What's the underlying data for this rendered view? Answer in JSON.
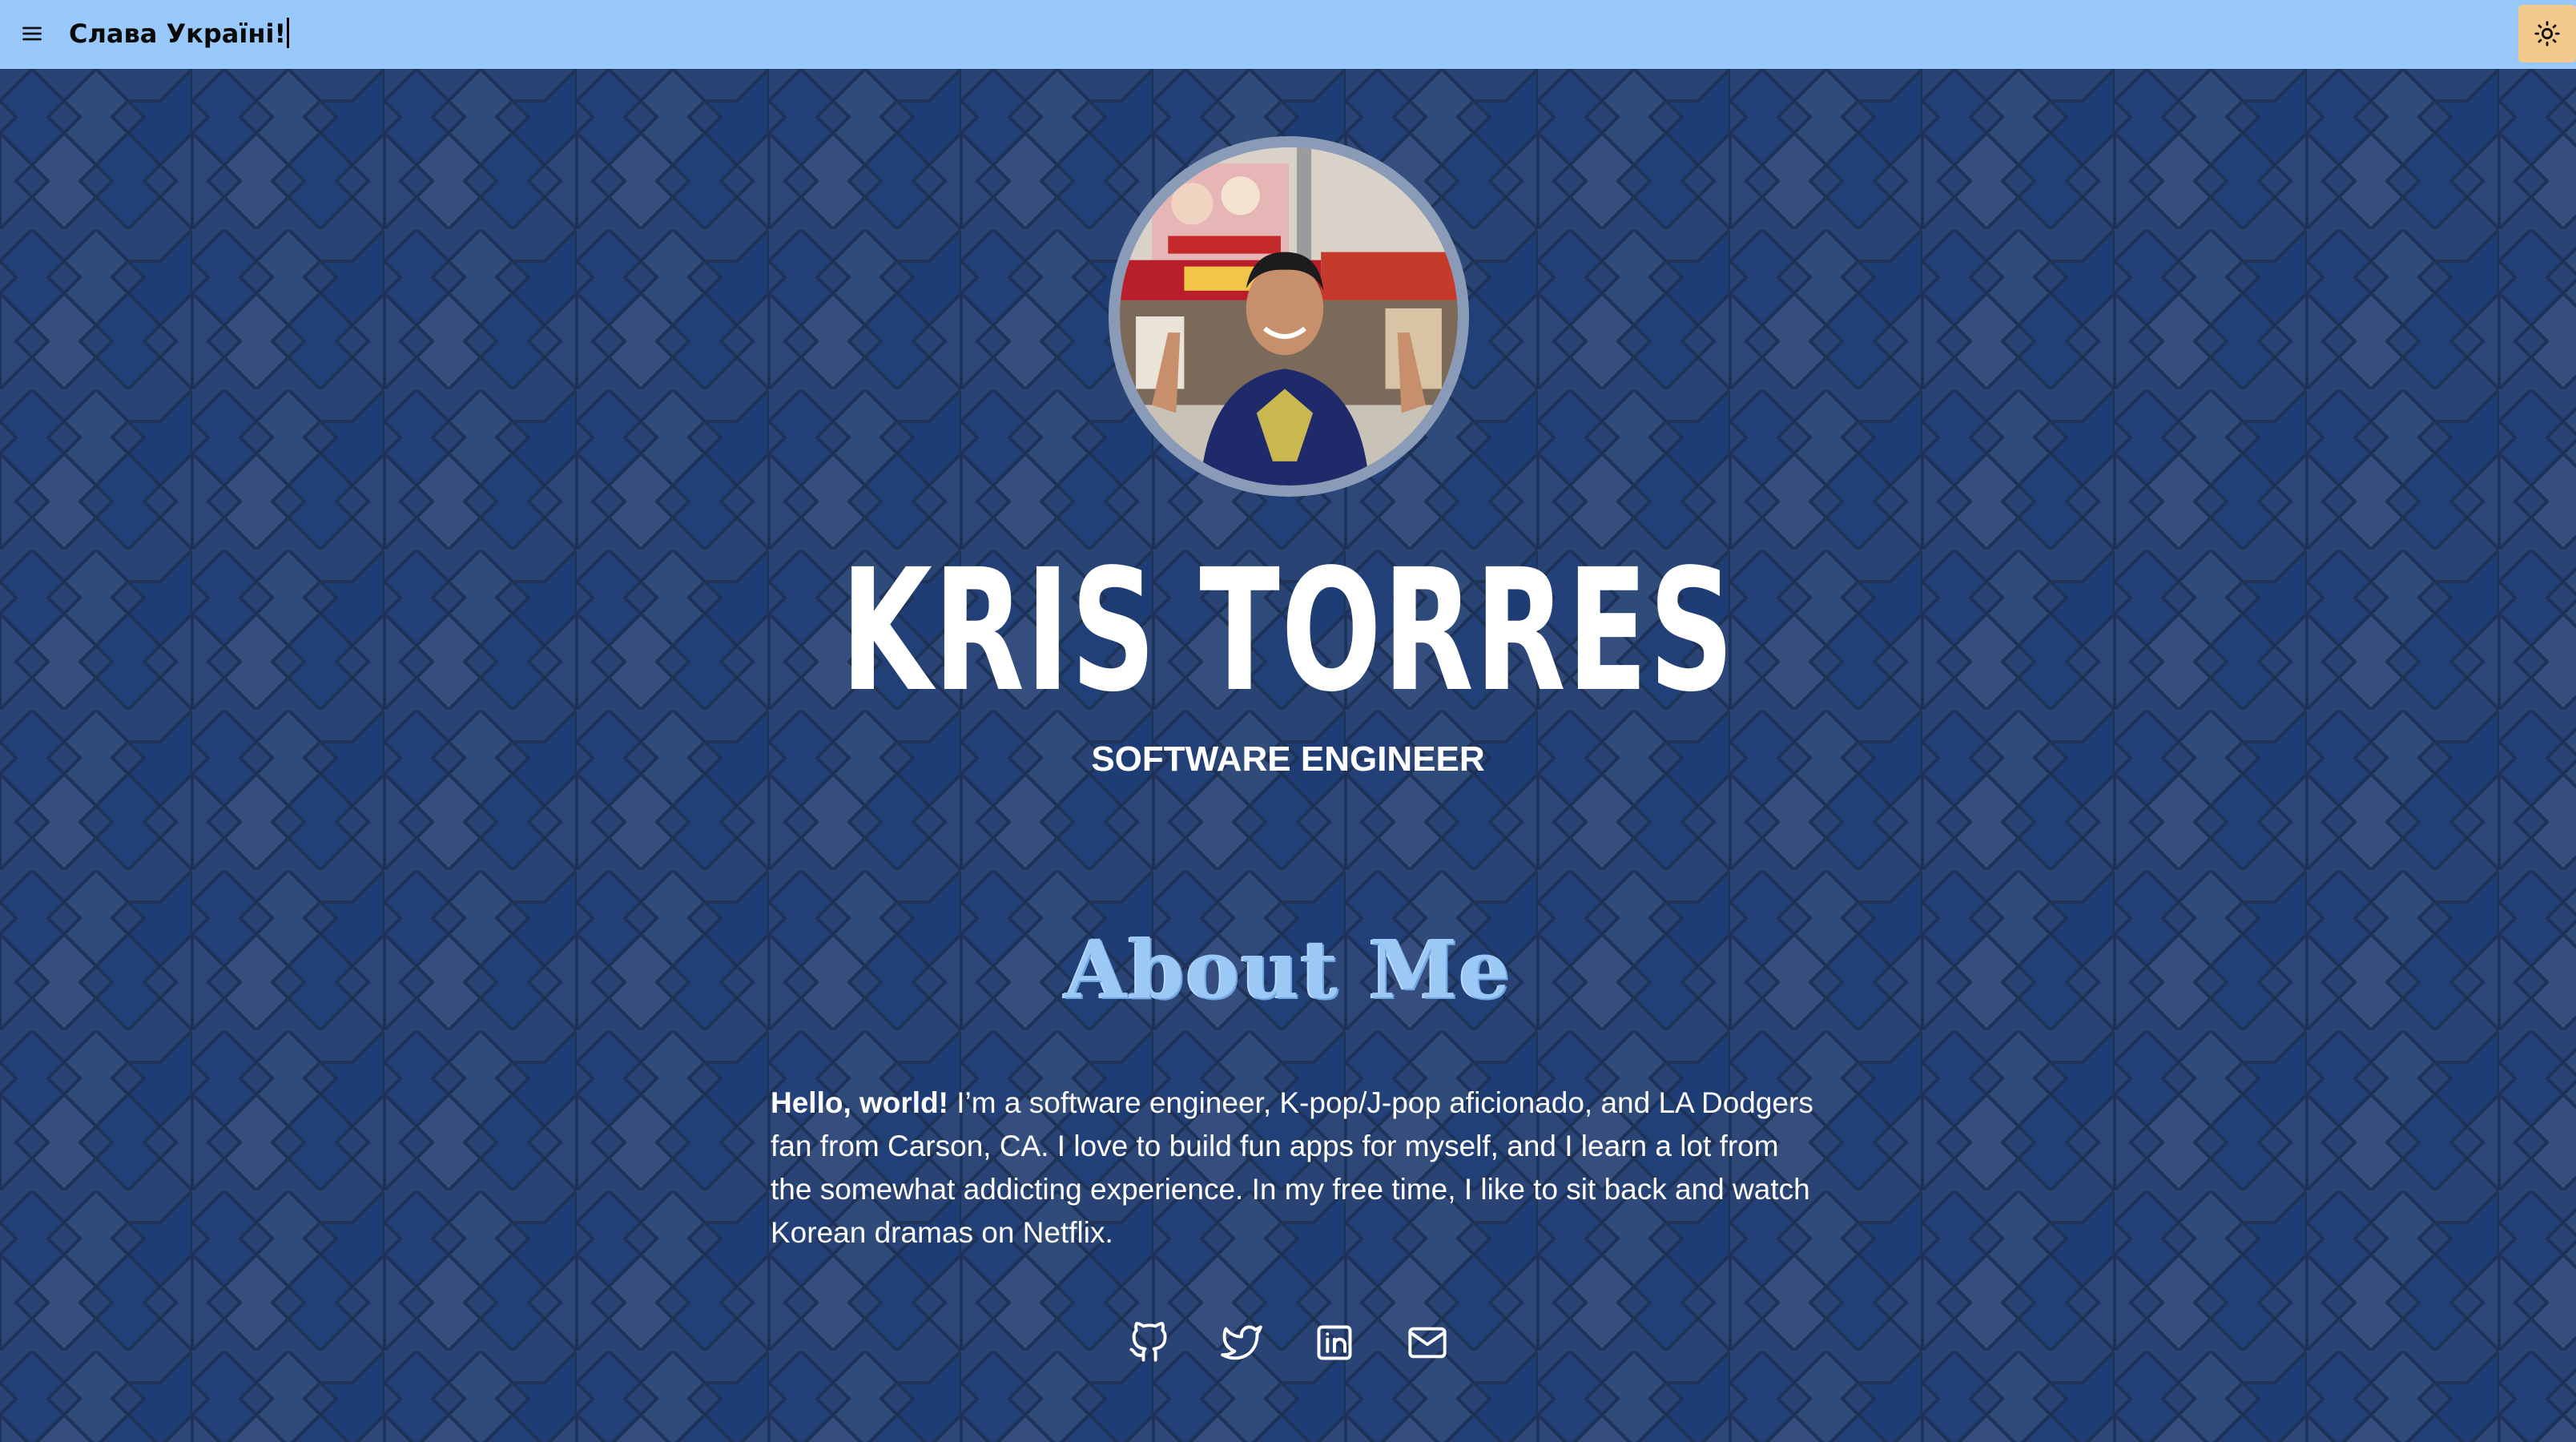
{
  "banner": {
    "text": "Слава Україні!"
  },
  "icons": {
    "menu": "menu-icon",
    "theme": "sun-icon",
    "github": "github-icon",
    "twitter": "twitter-icon",
    "linkedin": "linkedin-icon",
    "email": "mail-icon"
  },
  "profile": {
    "name": "KRIS TORRES",
    "title": "SOFTWARE ENGINEER"
  },
  "about": {
    "heading": "About Me",
    "intro_bold": "Hello, world!",
    "body": " I’m a software engineer, K-pop/J-pop aficionado, and LA Dodgers fan from Carson, CA. I love to build fun apps for myself, and I learn a lot from the somewhat addicting experience. In my free time, I like to sit back and watch Korean dramas on Netflix."
  },
  "colors": {
    "topbar": "#99c9fb",
    "background": "#2a4474",
    "theme_button": "#f2c98a",
    "about_heading": "#9cc8f6"
  }
}
